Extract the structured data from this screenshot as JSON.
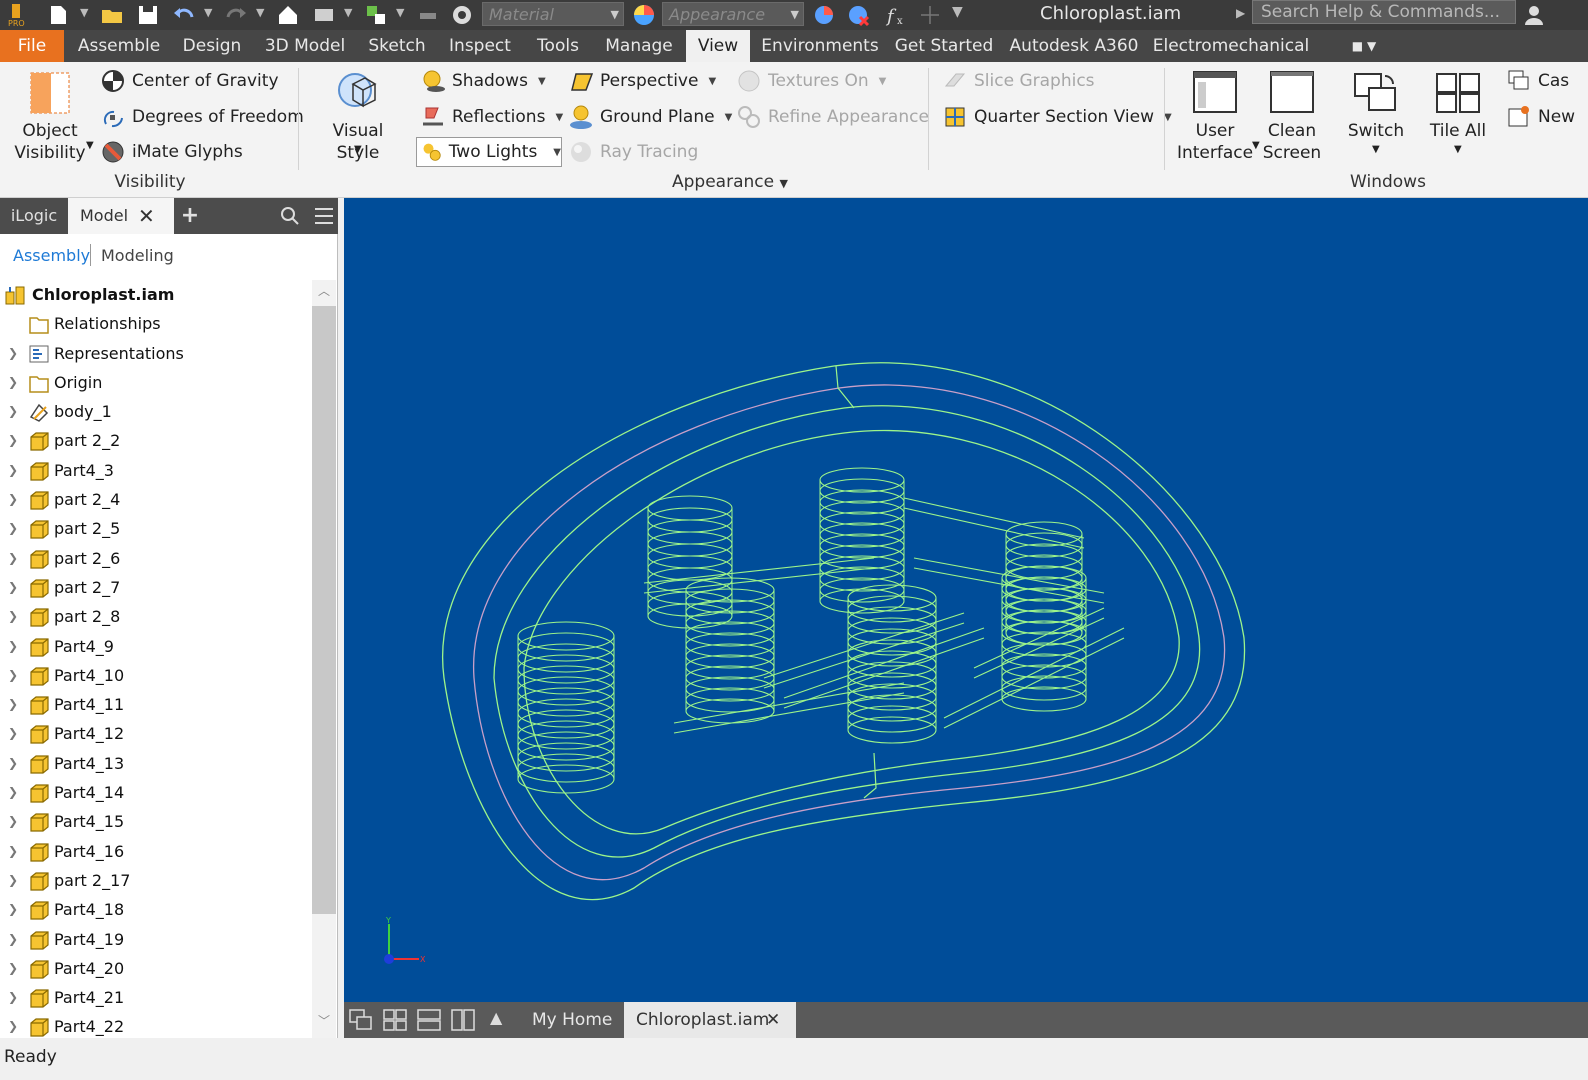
{
  "titlebar": {
    "material_placeholder": "Material",
    "appearance_placeholder": "Appearance",
    "document_title": "Chloroplast.iam",
    "search_placeholder": "Search Help & Commands..."
  },
  "menu": {
    "file": "File",
    "tabs": [
      "Assemble",
      "Design",
      "3D Model",
      "Sketch",
      "Inspect",
      "Tools",
      "Manage",
      "View",
      "Environments",
      "Get Started",
      "Autodesk A360",
      "Electromechanical"
    ],
    "active_tab": "View"
  },
  "ribbon": {
    "visibility": {
      "object_visibility": "Object Visibility",
      "center_of_gravity": "Center of Gravity",
      "degrees_of_freedom": "Degrees of Freedom",
      "imate_glyphs": "iMate Glyphs",
      "label": "Visibility"
    },
    "appearance": {
      "visual_style": "Visual Style",
      "shadows": "Shadows",
      "reflections": "Reflections",
      "two_lights": "Two Lights",
      "perspective": "Perspective",
      "ground_plane": "Ground Plane",
      "ray_tracing": "Ray Tracing",
      "textures_on": "Textures On",
      "refine_appearance": "Refine Appearance",
      "label": "Appearance"
    },
    "section": {
      "slice_graphics": "Slice Graphics",
      "quarter_section_view": "Quarter Section View"
    },
    "windows": {
      "user_interface": "User Interface",
      "clean_screen": "Clean Screen",
      "switch": "Switch",
      "tile_all": "Tile All",
      "cascade": "Cas",
      "new": "New",
      "label": "Windows"
    }
  },
  "browser": {
    "tabs": [
      "iLogic",
      "Model"
    ],
    "sub_tabs": [
      "Assembly",
      "Modeling"
    ],
    "root": "Chloroplast.iam",
    "items": [
      "Relationships",
      "Representations",
      "Origin",
      "body_1",
      "part 2_2",
      "Part4_3",
      "part 2_4",
      "part 2_5",
      "part 2_6",
      "part 2_7",
      "part 2_8",
      "Part4_9",
      "Part4_10",
      "Part4_11",
      "Part4_12",
      "Part4_13",
      "Part4_14",
      "Part4_15",
      "Part4_16",
      "part 2_17",
      "Part4_18",
      "Part4_19",
      "Part4_20",
      "Part4_21",
      "Part4_22"
    ]
  },
  "document_tabs": [
    "My Home",
    "Chloroplast.iam"
  ],
  "status": "Ready",
  "colors": {
    "viewport_bg": "#004d99",
    "wireframe": "#9cf58a",
    "accent_file": "#e8711f"
  }
}
